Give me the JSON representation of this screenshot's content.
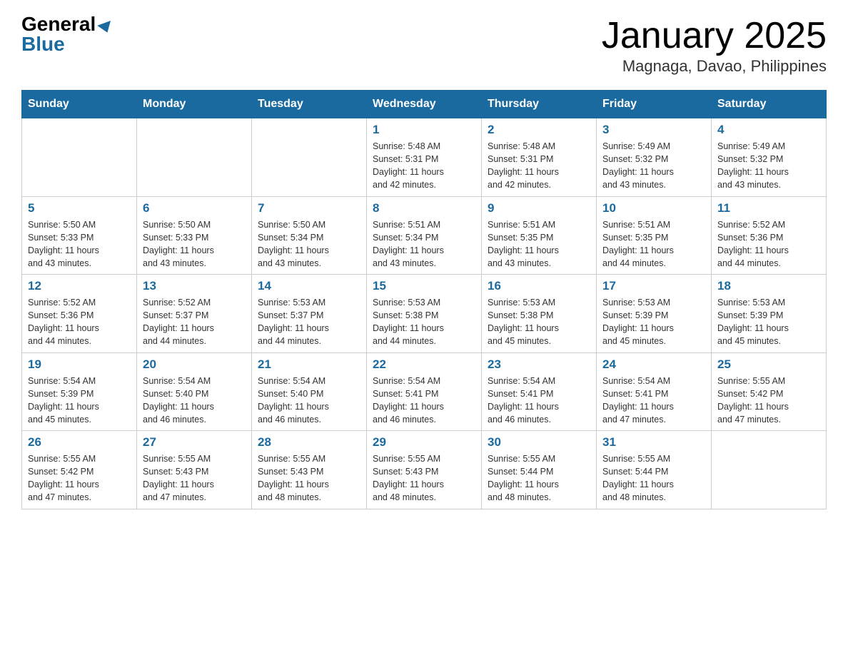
{
  "header": {
    "logo_general": "General",
    "logo_blue": "Blue",
    "month_title": "January 2025",
    "location": "Magnaga, Davao, Philippines"
  },
  "weekdays": [
    "Sunday",
    "Monday",
    "Tuesday",
    "Wednesday",
    "Thursday",
    "Friday",
    "Saturday"
  ],
  "weeks": [
    [
      {
        "day": "",
        "info": ""
      },
      {
        "day": "",
        "info": ""
      },
      {
        "day": "",
        "info": ""
      },
      {
        "day": "1",
        "info": "Sunrise: 5:48 AM\nSunset: 5:31 PM\nDaylight: 11 hours\nand 42 minutes."
      },
      {
        "day": "2",
        "info": "Sunrise: 5:48 AM\nSunset: 5:31 PM\nDaylight: 11 hours\nand 42 minutes."
      },
      {
        "day": "3",
        "info": "Sunrise: 5:49 AM\nSunset: 5:32 PM\nDaylight: 11 hours\nand 43 minutes."
      },
      {
        "day": "4",
        "info": "Sunrise: 5:49 AM\nSunset: 5:32 PM\nDaylight: 11 hours\nand 43 minutes."
      }
    ],
    [
      {
        "day": "5",
        "info": "Sunrise: 5:50 AM\nSunset: 5:33 PM\nDaylight: 11 hours\nand 43 minutes."
      },
      {
        "day": "6",
        "info": "Sunrise: 5:50 AM\nSunset: 5:33 PM\nDaylight: 11 hours\nand 43 minutes."
      },
      {
        "day": "7",
        "info": "Sunrise: 5:50 AM\nSunset: 5:34 PM\nDaylight: 11 hours\nand 43 minutes."
      },
      {
        "day": "8",
        "info": "Sunrise: 5:51 AM\nSunset: 5:34 PM\nDaylight: 11 hours\nand 43 minutes."
      },
      {
        "day": "9",
        "info": "Sunrise: 5:51 AM\nSunset: 5:35 PM\nDaylight: 11 hours\nand 43 minutes."
      },
      {
        "day": "10",
        "info": "Sunrise: 5:51 AM\nSunset: 5:35 PM\nDaylight: 11 hours\nand 44 minutes."
      },
      {
        "day": "11",
        "info": "Sunrise: 5:52 AM\nSunset: 5:36 PM\nDaylight: 11 hours\nand 44 minutes."
      }
    ],
    [
      {
        "day": "12",
        "info": "Sunrise: 5:52 AM\nSunset: 5:36 PM\nDaylight: 11 hours\nand 44 minutes."
      },
      {
        "day": "13",
        "info": "Sunrise: 5:52 AM\nSunset: 5:37 PM\nDaylight: 11 hours\nand 44 minutes."
      },
      {
        "day": "14",
        "info": "Sunrise: 5:53 AM\nSunset: 5:37 PM\nDaylight: 11 hours\nand 44 minutes."
      },
      {
        "day": "15",
        "info": "Sunrise: 5:53 AM\nSunset: 5:38 PM\nDaylight: 11 hours\nand 44 minutes."
      },
      {
        "day": "16",
        "info": "Sunrise: 5:53 AM\nSunset: 5:38 PM\nDaylight: 11 hours\nand 45 minutes."
      },
      {
        "day": "17",
        "info": "Sunrise: 5:53 AM\nSunset: 5:39 PM\nDaylight: 11 hours\nand 45 minutes."
      },
      {
        "day": "18",
        "info": "Sunrise: 5:53 AM\nSunset: 5:39 PM\nDaylight: 11 hours\nand 45 minutes."
      }
    ],
    [
      {
        "day": "19",
        "info": "Sunrise: 5:54 AM\nSunset: 5:39 PM\nDaylight: 11 hours\nand 45 minutes."
      },
      {
        "day": "20",
        "info": "Sunrise: 5:54 AM\nSunset: 5:40 PM\nDaylight: 11 hours\nand 46 minutes."
      },
      {
        "day": "21",
        "info": "Sunrise: 5:54 AM\nSunset: 5:40 PM\nDaylight: 11 hours\nand 46 minutes."
      },
      {
        "day": "22",
        "info": "Sunrise: 5:54 AM\nSunset: 5:41 PM\nDaylight: 11 hours\nand 46 minutes."
      },
      {
        "day": "23",
        "info": "Sunrise: 5:54 AM\nSunset: 5:41 PM\nDaylight: 11 hours\nand 46 minutes."
      },
      {
        "day": "24",
        "info": "Sunrise: 5:54 AM\nSunset: 5:41 PM\nDaylight: 11 hours\nand 47 minutes."
      },
      {
        "day": "25",
        "info": "Sunrise: 5:55 AM\nSunset: 5:42 PM\nDaylight: 11 hours\nand 47 minutes."
      }
    ],
    [
      {
        "day": "26",
        "info": "Sunrise: 5:55 AM\nSunset: 5:42 PM\nDaylight: 11 hours\nand 47 minutes."
      },
      {
        "day": "27",
        "info": "Sunrise: 5:55 AM\nSunset: 5:43 PM\nDaylight: 11 hours\nand 47 minutes."
      },
      {
        "day": "28",
        "info": "Sunrise: 5:55 AM\nSunset: 5:43 PM\nDaylight: 11 hours\nand 48 minutes."
      },
      {
        "day": "29",
        "info": "Sunrise: 5:55 AM\nSunset: 5:43 PM\nDaylight: 11 hours\nand 48 minutes."
      },
      {
        "day": "30",
        "info": "Sunrise: 5:55 AM\nSunset: 5:44 PM\nDaylight: 11 hours\nand 48 minutes."
      },
      {
        "day": "31",
        "info": "Sunrise: 5:55 AM\nSunset: 5:44 PM\nDaylight: 11 hours\nand 48 minutes."
      },
      {
        "day": "",
        "info": ""
      }
    ]
  ]
}
